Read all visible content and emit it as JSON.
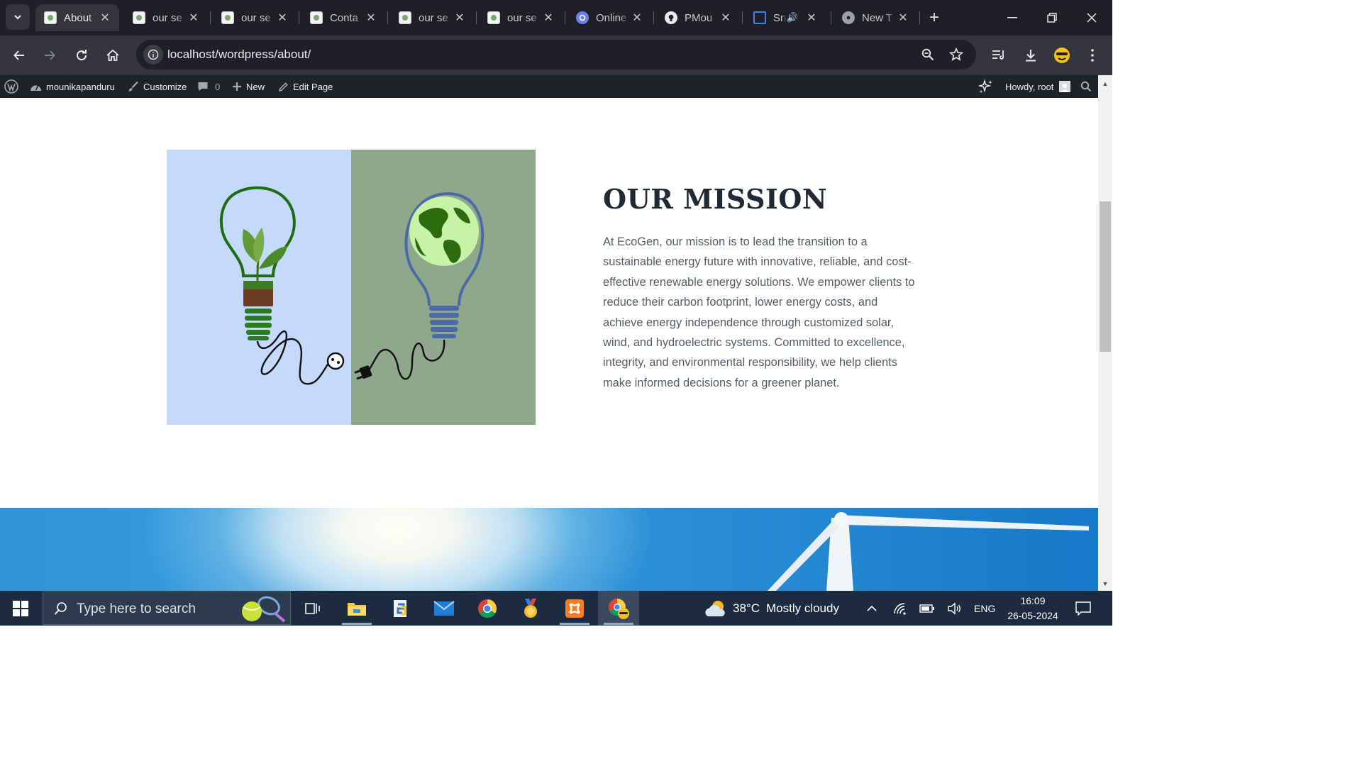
{
  "browser": {
    "tabs": [
      {
        "title": "About",
        "favicon": "ecogen-favicon",
        "active": true
      },
      {
        "title": "our se",
        "favicon": "ecogen-favicon",
        "active": false
      },
      {
        "title": "our se",
        "favicon": "ecogen-favicon",
        "active": false
      },
      {
        "title": "Conta",
        "favicon": "ecogen-favicon",
        "active": false
      },
      {
        "title": "our se",
        "favicon": "ecogen-favicon",
        "active": false
      },
      {
        "title": "our se",
        "favicon": "ecogen-favicon",
        "active": false
      },
      {
        "title": "Online",
        "favicon": "sync-favicon",
        "active": false
      },
      {
        "title": "PMou",
        "favicon": "github-favicon",
        "active": false
      },
      {
        "title": "Sn",
        "favicon": "snip-favicon",
        "active": false,
        "audio": true
      },
      {
        "title": "New T",
        "favicon": "chrome-favicon",
        "active": false
      }
    ],
    "new_tab_label": "+",
    "url": "localhost/wordpress/about/"
  },
  "wp_admin_bar": {
    "site_name": "mounikapanduru",
    "customize": "Customize",
    "comments_count": "0",
    "new": "New",
    "edit_page": "Edit Page",
    "howdy": "Howdy, root"
  },
  "mission": {
    "title": "OUR MISSION",
    "body": "At EcoGen, our mission is to lead the transition to a sustainable energy future with innovative, reliable, and cost-effective renewable energy solutions. We empower clients to reduce their carbon footprint, lower energy costs, and achieve energy independence through customized solar, wind, and hydroelectric systems. Committed to excellence, integrity, and environmental responsibility, we help clients make informed decisions for a greener planet.",
    "image_colors": {
      "left_panel": "#c5d9fb",
      "right_panel": "#8fa88b"
    }
  },
  "taskbar": {
    "search_placeholder": "Type here to search",
    "weather_temp": "38°C",
    "weather_text": "Mostly cloudy",
    "language": "ENG",
    "time": "16:09",
    "date": "26-05-2024"
  }
}
